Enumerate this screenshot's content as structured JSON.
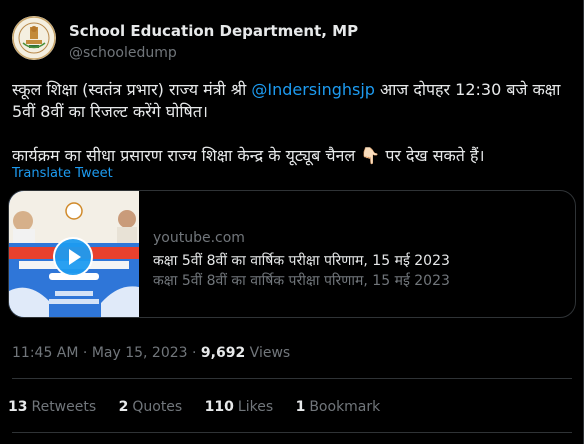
{
  "author": {
    "name": "School Education Department, MP",
    "handle": "@schooledump"
  },
  "tweet": {
    "line1_pre": "स्कूल शिक्षा (स्वतंत्र प्रभार) राज्य मंत्री श्री ",
    "mention": "@Indersinghsjp",
    "line1_post": " आज दोपहर 12:30 बजे कक्षा",
    "line2": "5वीं 8वीं का रिजल्ट करेंगे घोषित।",
    "para2_pre": " कार्यक्रम का सीधा प्रसारण राज्य शिक्षा केन्द्र के यूट्यूब चैनल ",
    "para2_emoji": "👇🏻",
    "para2_post": " पर देख सकते हैं।",
    "translate_label": "Translate Tweet"
  },
  "card": {
    "domain": "youtube.com",
    "title": "कक्षा 5वीं 8वीं का वार्षिक परीक्षा परिणाम, 15 मई 2023",
    "description": "कक्षा 5वीं 8वीं का वार्षिक परीक्षा परिणाम, 15 मई 2023",
    "thumb_text_1": "कक्षा 5वीं एवं 8वीं वार्षिक परीक्षा",
    "thumb_text_2": "परिणाम, वर्ष भर के परिणाम और समझ का",
    "thumb_text_3": "15 मई 2023",
    "thumb_text_4": "राज्य शिक्षा केन्द्र",
    "thumb_text_5": "स्कूल शिक्षा विभाग, (म.प्र.)"
  },
  "meta": {
    "time": "11:45 AM",
    "separator": " · ",
    "date": "May 15, 2023",
    "views_count": "9,692",
    "views_label": "Views"
  },
  "stats": [
    {
      "count": "13",
      "label": "Retweets"
    },
    {
      "count": "2",
      "label": "Quotes"
    },
    {
      "count": "110",
      "label": "Likes"
    },
    {
      "count": "1",
      "label": "Bookmark"
    }
  ],
  "colors": {
    "background": "#000000",
    "link": "#1d9bf0",
    "secondary_text": "#71767b",
    "primary_text": "#e7e9ea",
    "border": "#2f3336"
  },
  "icons": {
    "avatar": "mp-government-emblem-icon",
    "play": "play-icon"
  }
}
